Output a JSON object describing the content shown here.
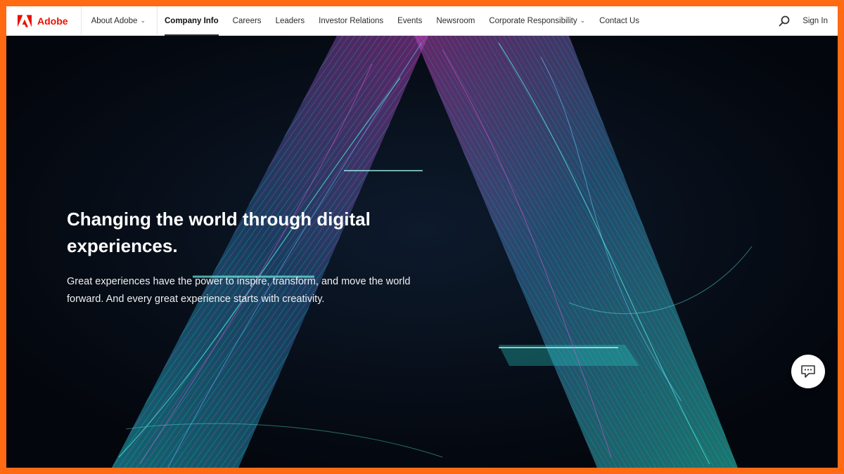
{
  "brand": {
    "name": "Adobe",
    "logo_icon": "adobe-logo-icon",
    "color": "#eb1000"
  },
  "nav": {
    "about": "About Adobe",
    "items": [
      {
        "label": "Company Info",
        "active": true
      },
      {
        "label": "Careers"
      },
      {
        "label": "Leaders"
      },
      {
        "label": "Investor Relations"
      },
      {
        "label": "Events"
      },
      {
        "label": "Newsroom"
      },
      {
        "label": "Corporate Responsibility",
        "dropdown": true
      },
      {
        "label": "Contact Us"
      }
    ],
    "search_icon": "search-icon",
    "signin": "Sign In"
  },
  "hero": {
    "title_line1": "Changing the world through digital",
    "title_line2": "experiences.",
    "subtitle_line1": "Great experiences have the power to inspire, transform, and move the world",
    "subtitle_line2": "forward. And every great experience starts with creativity.",
    "chat_icon": "chat-icon"
  },
  "colors": {
    "frame": "#ff6a13",
    "hero_bg": "#050a12",
    "accent_teal": "#2fd3c8",
    "accent_magenta": "#c03cc8"
  }
}
